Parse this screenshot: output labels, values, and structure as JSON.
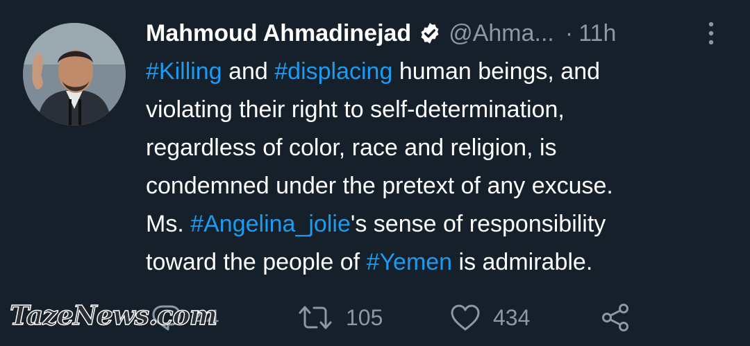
{
  "tweet": {
    "author": {
      "display_name": "Mahmoud Ahmadinejad",
      "handle": "@Ahma...",
      "verified_icon": "verified-badge-icon"
    },
    "separator": "·",
    "time": "11h",
    "more_icon": "more-vertical-icon",
    "body_lines": [
      [
        {
          "text": "#Killing",
          "tag": true
        },
        {
          "text": " and ",
          "tag": false
        },
        {
          "text": "#displacing",
          "tag": true
        },
        {
          "text": " human beings, and",
          "tag": false
        }
      ],
      [
        {
          "text": "violating their right to self-determination,",
          "tag": false
        }
      ],
      [
        {
          "text": "regardless of color, race and religion, is",
          "tag": false
        }
      ],
      [
        {
          "text": "condemned under the pretext of any excuse.",
          "tag": false
        }
      ],
      [
        {
          "text": "Ms. ",
          "tag": false
        },
        {
          "text": "#Angelina_jolie",
          "tag": true
        },
        {
          "text": "'s sense of responsibility",
          "tag": false
        }
      ],
      [
        {
          "text": "toward the people of ",
          "tag": false
        },
        {
          "text": "#Yemen",
          "tag": true
        },
        {
          "text": " is admirable.",
          "tag": false
        }
      ]
    ],
    "actions": {
      "reply": {
        "icon": "reply-icon",
        "count": "44"
      },
      "retweet": {
        "icon": "retweet-icon",
        "count": "105"
      },
      "like": {
        "icon": "heart-icon",
        "count": "434"
      },
      "share": {
        "icon": "share-icon"
      }
    }
  },
  "watermark": "TazeNews.com",
  "colors": {
    "background": "#15202b",
    "text": "#ffffff",
    "muted": "#8b98a5",
    "hashtag": "#1d9bf0"
  }
}
